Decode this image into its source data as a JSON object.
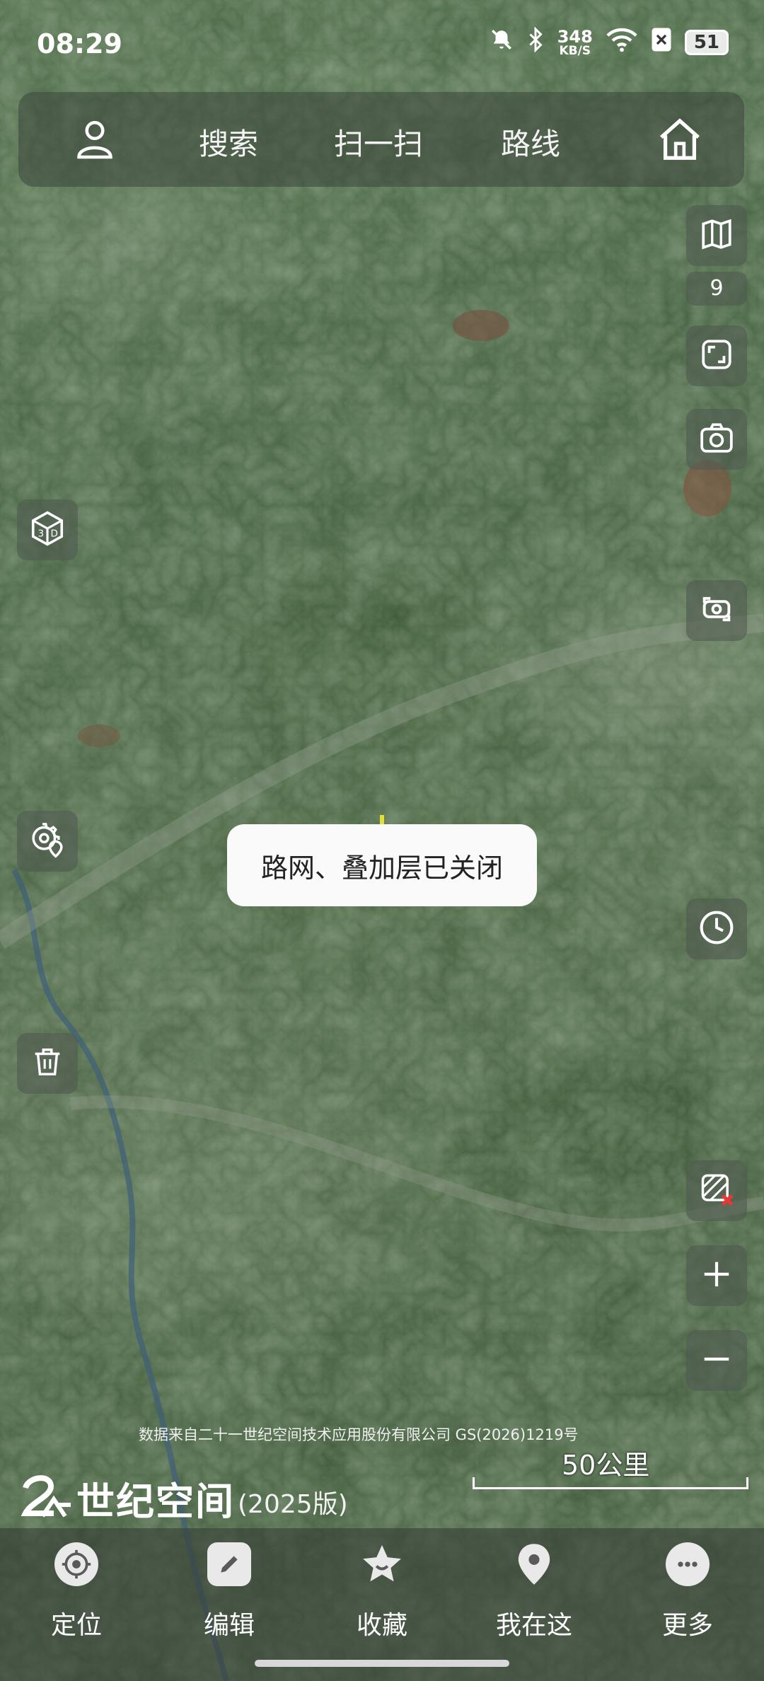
{
  "status_bar": {
    "time": "08:29",
    "network_speed_value": "348",
    "network_speed_unit": "KB/S",
    "battery": "51"
  },
  "top_bar": {
    "search_label": "搜索",
    "scan_label": "扫一扫",
    "route_label": "路线"
  },
  "right_panel": {
    "layer_count": "9"
  },
  "toast": {
    "message": "路网、叠加层已关闭"
  },
  "map": {
    "attribution": "数据来自二十一世纪空间技术应用股份有限公司 GS(2026)1219号",
    "scale_label": "50公里",
    "brand_name": "世纪空间",
    "brand_version": "(2025版)"
  },
  "bottom_nav": {
    "items": [
      {
        "label": "定位",
        "icon": "locate-icon"
      },
      {
        "label": "编辑",
        "icon": "edit-icon"
      },
      {
        "label": "收藏",
        "icon": "favorite-icon"
      },
      {
        "label": "我在这",
        "icon": "location-pin-icon"
      },
      {
        "label": "更多",
        "icon": "more-icon"
      }
    ]
  },
  "colors": {
    "toast_bg": "#fafafa",
    "panel_bg": "rgba(80,90,80,0.6)",
    "alert_red": "#e53935"
  }
}
